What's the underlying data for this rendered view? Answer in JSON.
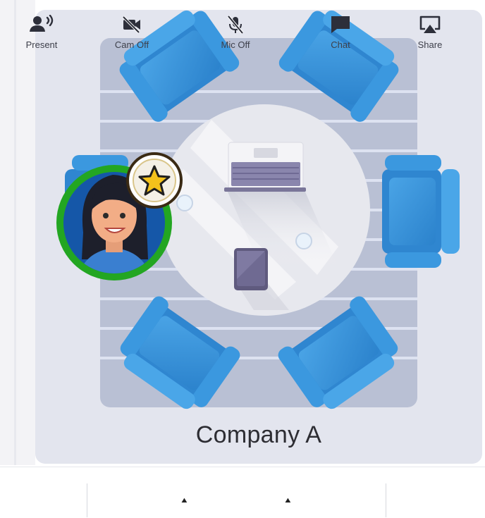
{
  "room": {
    "name": "Company A"
  },
  "toolbar": {
    "present_label": "Present",
    "cam_label": "Cam Off",
    "mic_label": "Mic Off",
    "chat_label": "Chat",
    "share_label": "Share",
    "caret_glyph": "▲"
  },
  "icons": {
    "present": "person-speaking-icon",
    "cam": "camera-off-icon",
    "mic": "mic-off-icon",
    "chat": "chat-bubble-icon",
    "share": "screen-share-icon",
    "host_badge": "star-icon"
  },
  "colors": {
    "chair_blue": "#3a95dc",
    "avatar_ring": "#2aa722",
    "badge_star": "#f4c21b",
    "panel_bg": "#e3e5ee",
    "room_floor": "#b9c0d4"
  }
}
